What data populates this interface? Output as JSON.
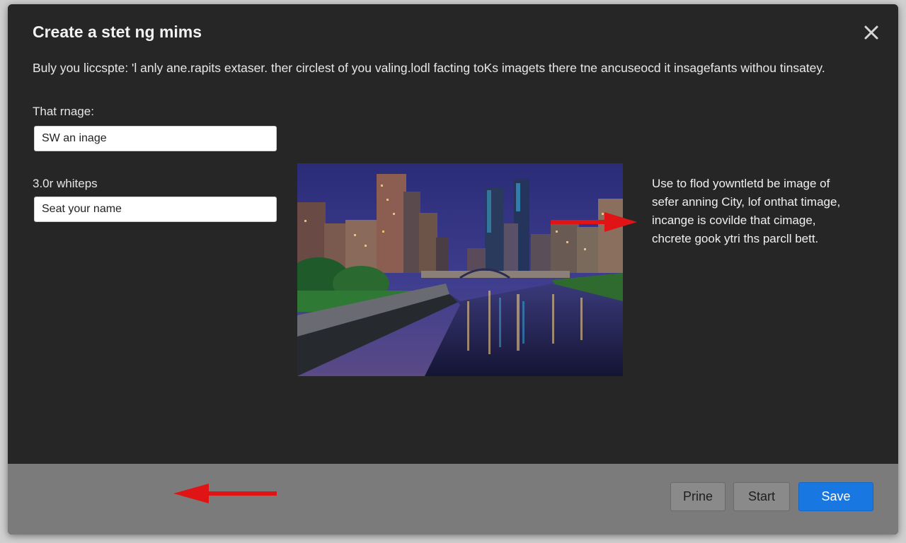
{
  "dialog": {
    "title": "Create a stet ng mims",
    "description": "Buly you liccspte: 'l anly ane.rapits extaser. ther circlest of you valing.lodl facting toKs imagets there tne ancuseocd it insagefants withou tinsatey.",
    "close_icon": "close-icon"
  },
  "form": {
    "image_field": {
      "label": "That rnage:",
      "placeholder": "SW an inage"
    },
    "name_field": {
      "label": "3.0r whiteps",
      "placeholder": "Seat your name"
    }
  },
  "preview": {
    "image_subject": "city skyline at night with river and bridge",
    "note_lines": [
      "Use to flod yowntletd be image of",
      "sefer anning City, lof onthat timage,",
      "incange is covilde that cimage,",
      "chcrete gook ytri ths parcll bett."
    ],
    "arrow_color": "#e01414"
  },
  "footer": {
    "buttons": {
      "prine": "Prine",
      "start": "Start",
      "save": "Save"
    },
    "primary_color": "#1877e0"
  }
}
